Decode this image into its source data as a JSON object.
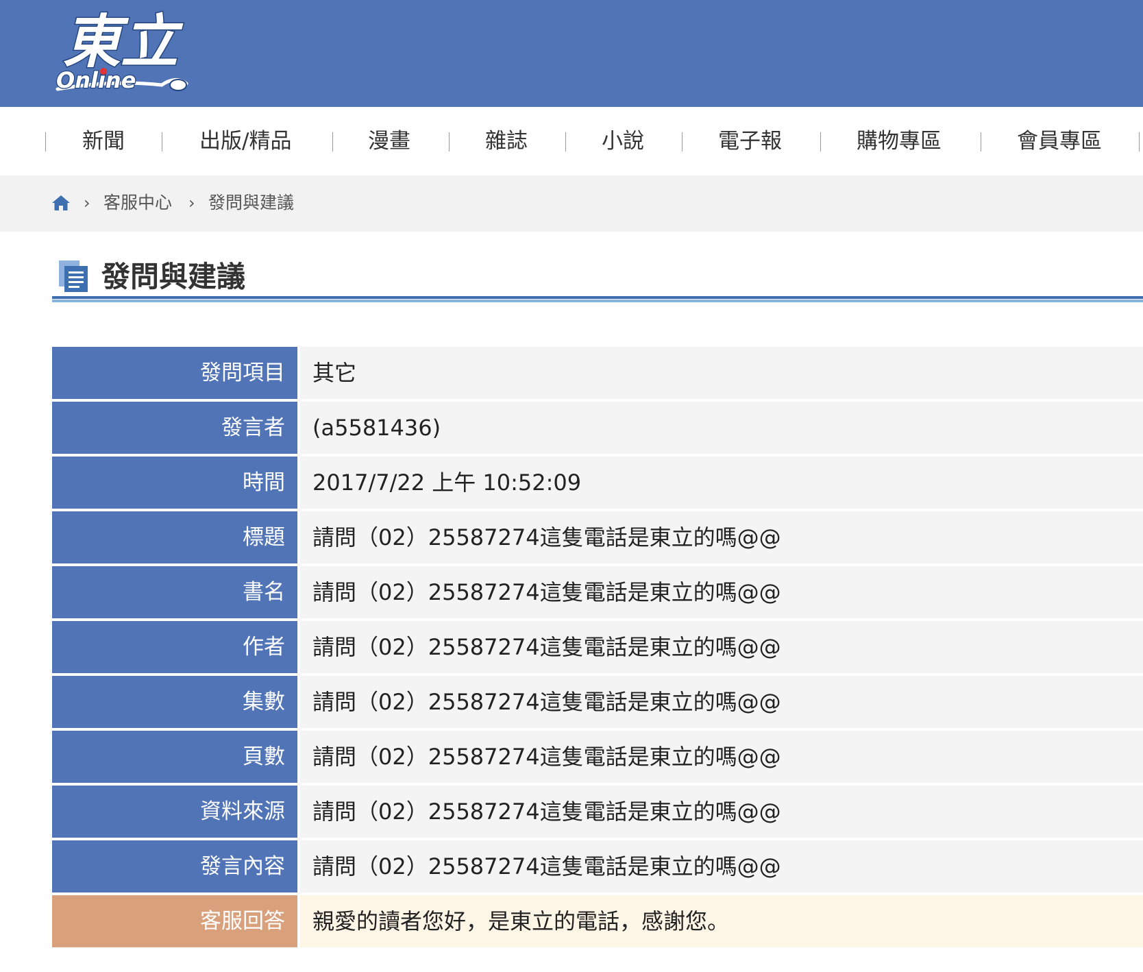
{
  "header": {
    "logo_text": "東立",
    "logo_subtext": "Online"
  },
  "nav": {
    "items": [
      {
        "label": "新聞"
      },
      {
        "label": "出版/精品"
      },
      {
        "label": "漫畫"
      },
      {
        "label": "雜誌"
      },
      {
        "label": "小說"
      },
      {
        "label": "電子報"
      },
      {
        "label": "購物專區"
      },
      {
        "label": "會員專區"
      }
    ]
  },
  "breadcrumb": {
    "home_icon": "home-icon",
    "items": [
      {
        "label": "客服中心"
      },
      {
        "label": "發問與建議"
      }
    ]
  },
  "page": {
    "title": "發問與建議",
    "title_icon": "document-icon"
  },
  "details": [
    {
      "label": "發問項目",
      "value": "其它"
    },
    {
      "label": "發言者",
      "value": "(a5581436)"
    },
    {
      "label": "時間",
      "value": "2017/7/22 上午 10:52:09"
    },
    {
      "label": "標題",
      "value": "請問（02）25587274這隻電話是東立的嗎@@"
    },
    {
      "label": "書名",
      "value": "請問（02）25587274這隻電話是東立的嗎@@"
    },
    {
      "label": "作者",
      "value": "請問（02）25587274這隻電話是東立的嗎@@"
    },
    {
      "label": "集數",
      "value": "請問（02）25587274這隻電話是東立的嗎@@"
    },
    {
      "label": "頁數",
      "value": "請問（02）25587274這隻電話是東立的嗎@@"
    },
    {
      "label": "資料來源",
      "value": "請問（02）25587274這隻電話是東立的嗎@@"
    },
    {
      "label": "發言內容",
      "value": "請問（02）25587274這隻電話是東立的嗎@@"
    }
  ],
  "answer": {
    "label": "客服回答",
    "value": "親愛的讀者您好，是東立的電話，感謝您。"
  },
  "colors": {
    "brand_blue": "#5174b7",
    "answer_label": "#d9a07c",
    "answer_background": "#fdf5e6",
    "value_background": "#f4f4f4"
  }
}
